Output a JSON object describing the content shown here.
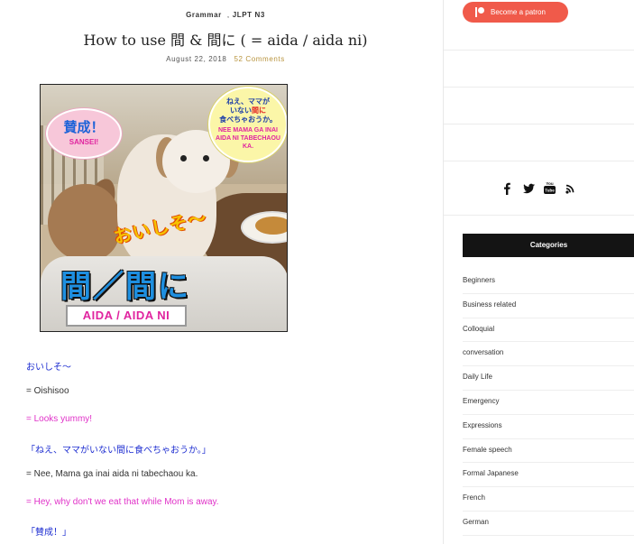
{
  "post": {
    "categories": [
      "Grammar",
      "JLPT N3"
    ],
    "title": "How to use 間 & 間に ( = aida / aida ni)",
    "date": "August 22, 2018",
    "comments": "52 Comments"
  },
  "featured_image": {
    "bubble_left_jp": "賛成！",
    "bubble_left_en": "SANSEI!",
    "bubble_right_jp_1": "ねえ、ママが",
    "bubble_right_jp_2": "いない",
    "bubble_right_jp_highlight": "間に",
    "bubble_right_jp_3": "食べちゃおうか。",
    "bubble_right_en": "NEE MAMA GA INAI AIDA NI TABECHAOU KA.",
    "overlay_jp": "おいしそ〜",
    "kanji_title": "間／間に",
    "romaji_label": "AIDA / AIDA NI"
  },
  "article": {
    "line1": "おいしそ〜",
    "line2": "= Oishisoo",
    "line3": "= Looks yummy!",
    "line4": "「ねえ、ママがいない間に食べちゃおうか。」",
    "line5": "= Nee, Mama ga inai aida ni tabechaou ka.",
    "line6": "= Hey, why don't we eat that while Mom is away.",
    "line7": "「賛成！」"
  },
  "sidebar": {
    "patron_label": "Become a patron",
    "social_icons": [
      "facebook-icon",
      "twitter-icon",
      "youtube-icon",
      "rss-icon"
    ],
    "categories_title": "Categories",
    "categories": [
      "Beginners",
      "Business related",
      "Colloquial",
      "conversation",
      "Daily Life",
      "Emergency",
      "Expressions",
      "Female speech",
      "Formal Japanese",
      "French",
      "German"
    ]
  },
  "colors": {
    "patron": "#f05a4a",
    "link_gold": "#b8943e",
    "text_blue": "#1f2fd1",
    "text_pink": "#e031c8"
  }
}
